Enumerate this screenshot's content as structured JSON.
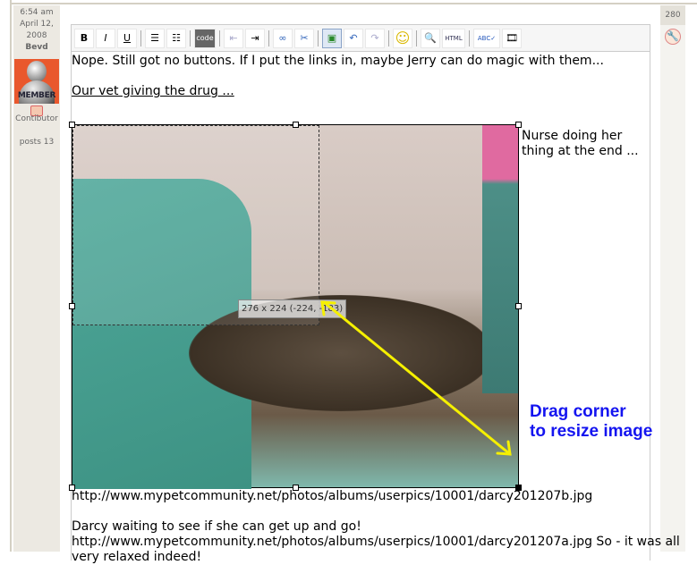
{
  "post": {
    "time": "6:54 am",
    "date_line1": "April 12,",
    "date_line2": "2008",
    "author": "Bevd",
    "avatar_label": "MEMBER",
    "role": "Contibutor",
    "posts": "posts 13"
  },
  "right": {
    "count": "280"
  },
  "toolbar": [
    {
      "name": "bold",
      "label": "B"
    },
    {
      "name": "italic",
      "label": "I"
    },
    {
      "name": "underline",
      "label": "U"
    },
    {
      "name": "bullet-list",
      "label": "☰"
    },
    {
      "name": "numbered-list",
      "label": "☷"
    },
    {
      "name": "code",
      "label": "code"
    },
    {
      "name": "outdent",
      "label": "⇤"
    },
    {
      "name": "indent",
      "label": "⇥"
    },
    {
      "name": "link",
      "label": "∞"
    },
    {
      "name": "unlink",
      "label": "✂"
    },
    {
      "name": "insert-image",
      "label": "▣"
    },
    {
      "name": "undo",
      "label": "↶"
    },
    {
      "name": "redo",
      "label": "↷"
    },
    {
      "name": "smiley",
      "label": "☺"
    },
    {
      "name": "preview",
      "label": "🔍"
    },
    {
      "name": "html",
      "label": "HTML"
    },
    {
      "name": "spellcheck",
      "label": "ABC✓"
    },
    {
      "name": "media",
      "label": "🎞"
    }
  ],
  "content": {
    "line1": "Nope. Still got no buttons. If I put the links in, maybe Jerry can do magic with them...",
    "line2": "Our vet giving the drug ...",
    "nurse_caption": "Nurse doing her thing at the end ...",
    "resize_tooltip": "276 x 224 (-224, -183)",
    "url1": "http://www.mypetcommunity.net/photos/albums/userpics/10001/darcy201207b.jpg",
    "line3": "Darcy waiting to see if she can get up and go!",
    "line4": "http://www.mypetcommunity.net/photos/albums/userpics/10001/darcy201207a.jpg So - it was all",
    "line5": "very relaxed indeed!"
  },
  "annotation": {
    "line1": "Drag corner",
    "line2": "to resize image",
    "color": "#1414f0",
    "arrow_color": "#f5f000"
  }
}
